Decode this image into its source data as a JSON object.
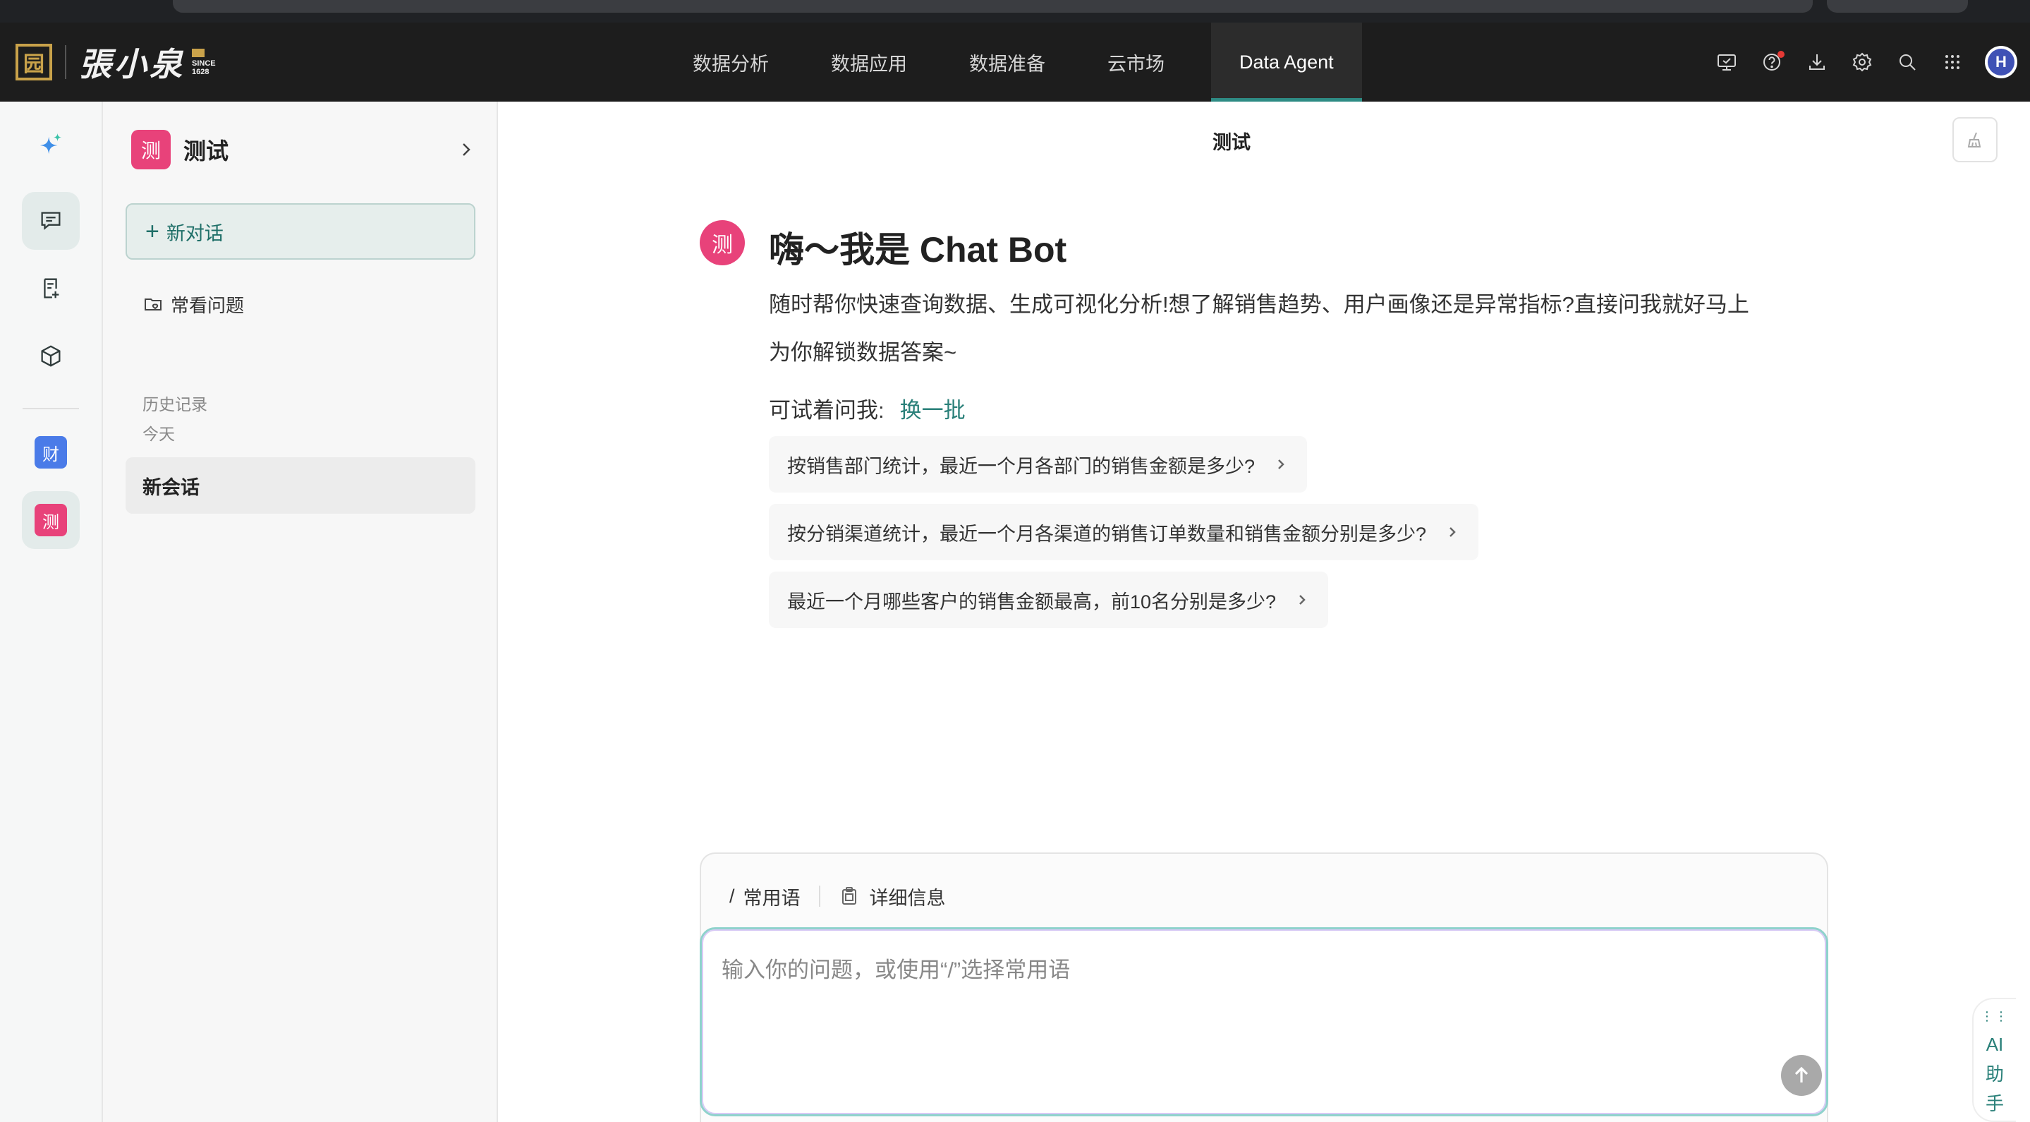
{
  "brand": {
    "seal": "园",
    "name": "張小泉",
    "since": "SINCE",
    "year": "1628"
  },
  "nav": {
    "items": [
      {
        "label": "数据分析"
      },
      {
        "label": "数据应用"
      },
      {
        "label": "数据准备"
      },
      {
        "label": "云市场"
      },
      {
        "label": "Data Agent"
      }
    ],
    "active": "Data Agent"
  },
  "top_icons": [
    "monitor-icon",
    "help-icon",
    "download-icon",
    "gear-icon",
    "search-icon",
    "apps-grid-icon"
  ],
  "user": {
    "avatar_letter": "H"
  },
  "rail": {
    "badges": [
      {
        "label": "财",
        "color": "#4a7be8"
      },
      {
        "label": "测",
        "color": "#e8427a"
      }
    ]
  },
  "sidebar": {
    "bot_badge": "测",
    "title": "测试",
    "new_chat_label": "新对话",
    "faq_label": "常看问题",
    "history_label": "历史记录",
    "today_label": "今天",
    "sessions": [
      {
        "label": "新会话"
      }
    ]
  },
  "main": {
    "title": "测试",
    "welcome": {
      "badge": "测",
      "title": "嗨～我是 Chat Bot",
      "description": "随时帮你快速查询数据、生成可视化分析!想了解销售趋势、用户画像还是异常指标?直接问我就好马上为你解锁数据答案~",
      "try_label": "可试着问我:",
      "swap_label": "换一批"
    },
    "suggestions": [
      {
        "text": "按销售部门统计，最近一个月各部门的销售金额是多少?"
      },
      {
        "text": "按分销渠道统计，最近一个月各渠道的销售订单数量和销售金额分别是多少?"
      },
      {
        "text": "最近一个月哪些客户的销售金额最高，前10名分别是多少?"
      }
    ]
  },
  "composer": {
    "slash": "/",
    "common_phrases_label": "常用语",
    "details_label": "详细信息",
    "placeholder": "输入你的问题，或使用“/”选择常用语",
    "value": ""
  },
  "ai_assistant": {
    "label": "AI助手",
    "chars": [
      "AI",
      "助",
      "手"
    ]
  },
  "colors": {
    "accent": "#2a8079",
    "badge_pink": "#e8427a",
    "badge_blue": "#4a7be8",
    "topbar": "#1d1d1d"
  }
}
